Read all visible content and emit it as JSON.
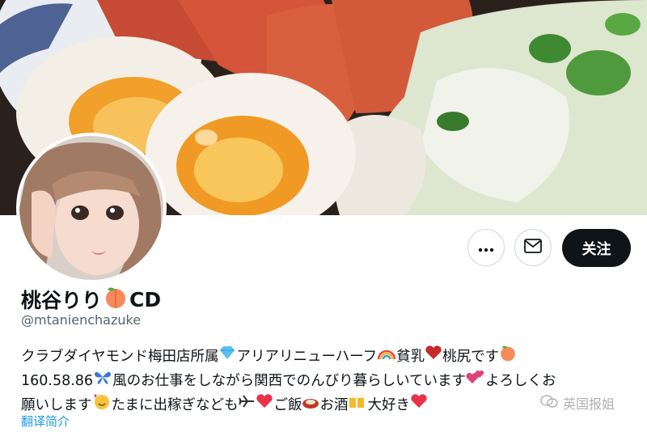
{
  "profile": {
    "display_name": "桃谷りり",
    "display_name_suffix": "CD",
    "handle": "@mtanienchazuke",
    "name_emoji": "peach-icon"
  },
  "actions": {
    "more_icon": "more-icon",
    "message_icon": "mail-icon",
    "follow_label": "关注"
  },
  "bio": {
    "line1_a": "クラブダイヤモンド梅田店所属",
    "line1_b": "アリアリニューハーフ",
    "line1_c": " 貧乳",
    "line1_d": "桃尻です",
    "line2_a": "160.58.86",
    "line2_b": "風のお仕事をしながら関西でのんびり暮らしいています",
    "line2_c": " よろしくお",
    "line3_a": "願いします",
    "line3_b": "たまに出稼ぎなども",
    "line3_c": "ご飯",
    "line3_d": "お酒",
    "line3_e": "大好き"
  },
  "translate_label": "翻译简介",
  "watermark": "英国报姐",
  "colors": {
    "follow_bg": "#0f1419",
    "link": "#1d9bf0",
    "secondary_text": "#536471"
  }
}
